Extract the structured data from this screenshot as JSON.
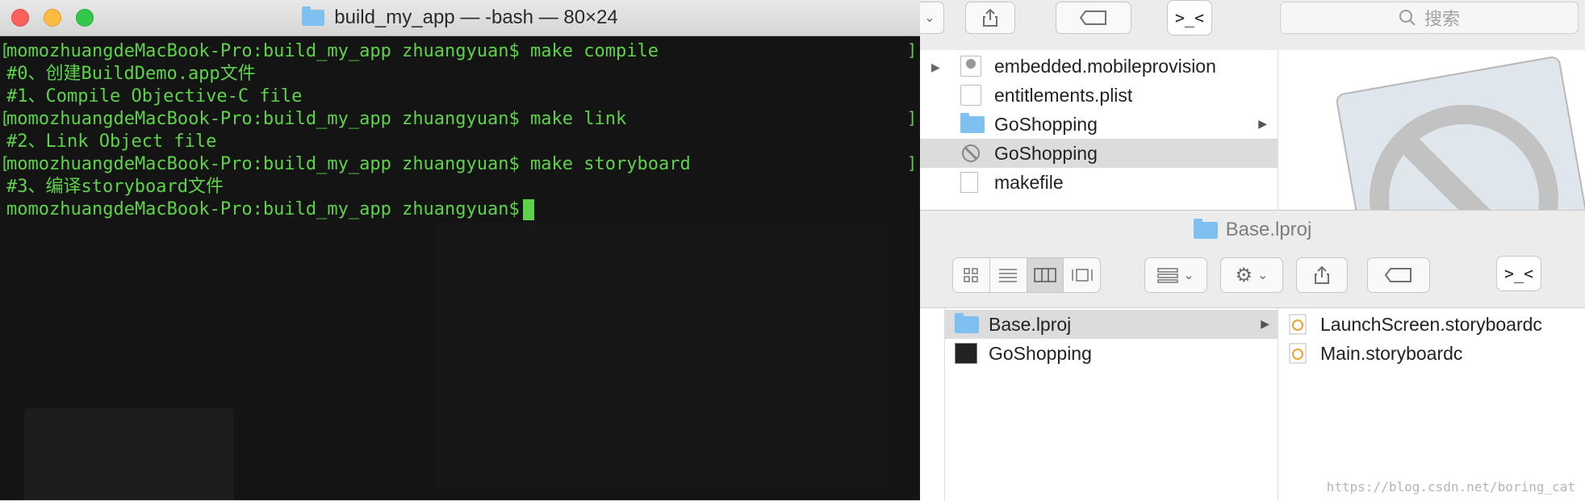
{
  "terminal": {
    "title": "build_my_app — -bash — 80×24",
    "lines": [
      "momozhuangdeMacBook-Pro:build_my_app zhuangyuan$ make compile",
      "#0、创建BuildDemo.app文件",
      "#1、Compile Objective-C file",
      "momozhuangdeMacBook-Pro:build_my_app zhuangyuan$ make link",
      "#2、Link Object file",
      "momozhuangdeMacBook-Pro:build_my_app zhuangyuan$ make storyboard",
      "#3、编译storyboard文件",
      "momozhuangdeMacBook-Pro:build_my_app zhuangyuan$"
    ]
  },
  "finder_top": {
    "search_placeholder": "搜索",
    "terminal_button": ">_<",
    "files": [
      {
        "name": "embedded.mobileprovision",
        "icon": "provision-file-icon"
      },
      {
        "name": "entitlements.plist",
        "icon": "plist-file-icon"
      },
      {
        "name": "GoShopping",
        "icon": "folder-icon",
        "has_arrow": true
      },
      {
        "name": "GoShopping",
        "icon": "blocked-app-icon",
        "selected": true
      },
      {
        "name": "makefile",
        "icon": "document-icon"
      }
    ]
  },
  "finder_bottom": {
    "title": "Base.lproj",
    "terminal_button": ">_<",
    "column1": [
      {
        "name": "Base.lproj",
        "icon": "folder-icon",
        "selected": true,
        "has_arrow": true
      },
      {
        "name": "GoShopping",
        "icon": "executable-icon"
      }
    ],
    "column2": [
      {
        "name": "LaunchScreen.storyboardc",
        "icon": "storyboard-file-icon"
      },
      {
        "name": "Main.storyboardc",
        "icon": "storyboard-file-icon"
      }
    ]
  },
  "watermark": "https://blog.csdn.net/boring_cat",
  "colors": {
    "terminal_text": "#5ed34a",
    "terminal_bg": "#141414",
    "folder": "#7ec0ef",
    "selection": "#dcdcdc"
  }
}
